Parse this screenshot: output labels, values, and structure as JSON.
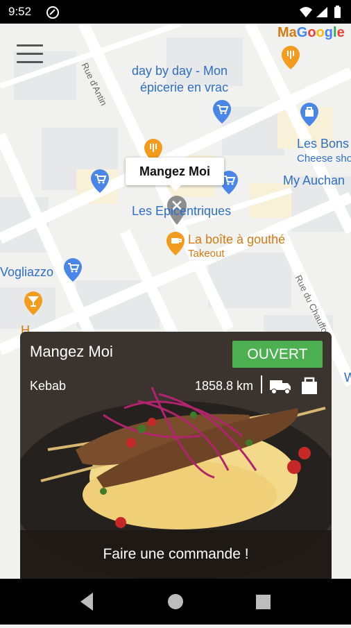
{
  "status": {
    "time": "9:52"
  },
  "map": {
    "labels": {
      "day_by_day_1": "day by day - Mon",
      "day_by_day_2": "épicerie en vrac",
      "les_bons": "Les Bons",
      "cheese": "Cheese sho",
      "my_auchan": "My Auchan",
      "les_epicentriques": "Les Epicentriques",
      "la_boite": "La boîte à gouthé",
      "takeout": "Takeout",
      "vogliazzo": "Vogliazzo",
      "ma": "Ma",
      "rue_antin": "Rue d'Antin",
      "rue_chauffour": "Rue du Chauffour",
      "partial_w": "W",
      "partial_h": "H"
    },
    "google_logo": "Google",
    "selected_marker_title": "Mangez Moi"
  },
  "card": {
    "title": "Mangez Moi",
    "status": "OUVERT",
    "category": "Kebab",
    "distance": "1858.8 km",
    "action": "Faire une commande !"
  },
  "colors": {
    "open_badge": "#4caf50",
    "map_blue": "#2d6ec7",
    "map_orange": "#d47a12"
  }
}
